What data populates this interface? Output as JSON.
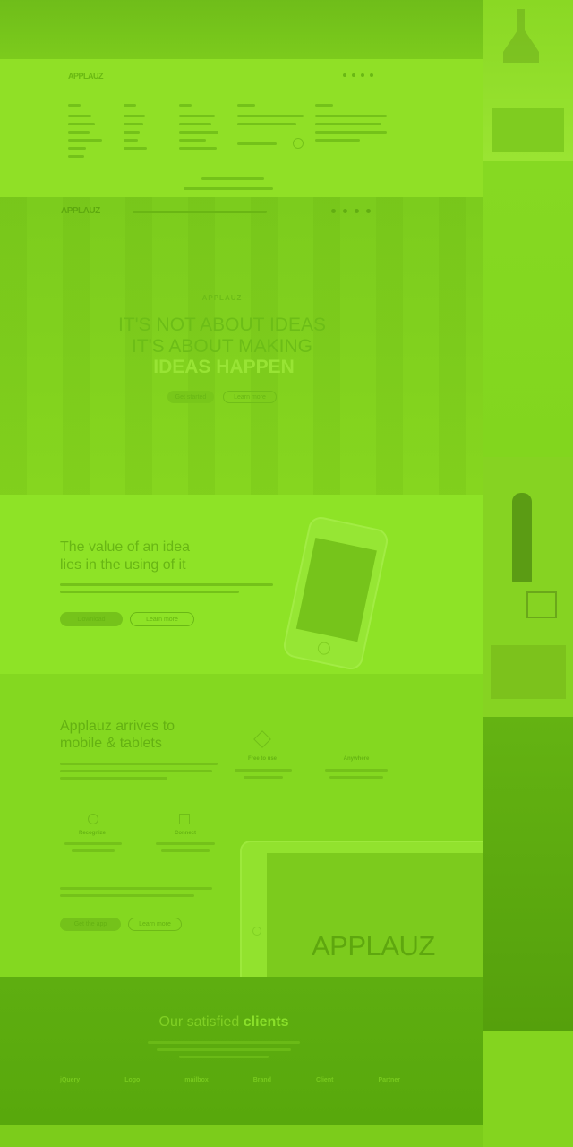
{
  "brand": {
    "logo": "APPLAUZ"
  },
  "footer_nav": {
    "logo": "APPLAUZ",
    "columns": [
      {
        "items": [
          "Applauz",
          "Features",
          "Pricing",
          "Customers",
          "Blog"
        ]
      },
      {
        "items": [
          "About",
          "Careers",
          "Press",
          "Legal"
        ]
      },
      {
        "items": [
          "Support",
          "Contact",
          "Security",
          "Status"
        ]
      }
    ]
  },
  "hero": {
    "nav_logo": "APPLAUZ",
    "kicker": "APPLAUZ",
    "line1": "IT'S NOT ABOUT IDEAS",
    "line2": "IT'S ABOUT MAKING",
    "line3": "IDEAS HAPPEN",
    "btn_primary": "Get started",
    "btn_secondary": "Learn more"
  },
  "value": {
    "heading_line1": "The value of an idea",
    "heading_line2": "lies in the using of it",
    "btn_primary": "Download",
    "btn_secondary": "Learn more"
  },
  "mobile": {
    "heading_line1": "Applauz arrives to",
    "heading_line2": "mobile & tablets",
    "feature1": "Free to use",
    "feature2": "Anywhere",
    "feature3": "Recognize",
    "feature4": "Connect",
    "btn_primary": "Get the app",
    "btn_secondary": "Learn more",
    "tablet_logo": "APPLAUZ"
  },
  "clients": {
    "heading_plain": "Our satisfied ",
    "heading_bold": "clients",
    "logos": [
      "jQuery",
      "Logo",
      "mailbox",
      "Brand",
      "Client",
      "Partner"
    ]
  },
  "colors": {
    "overlay": "#86da1f",
    "dark_band": "#5aa80e"
  }
}
